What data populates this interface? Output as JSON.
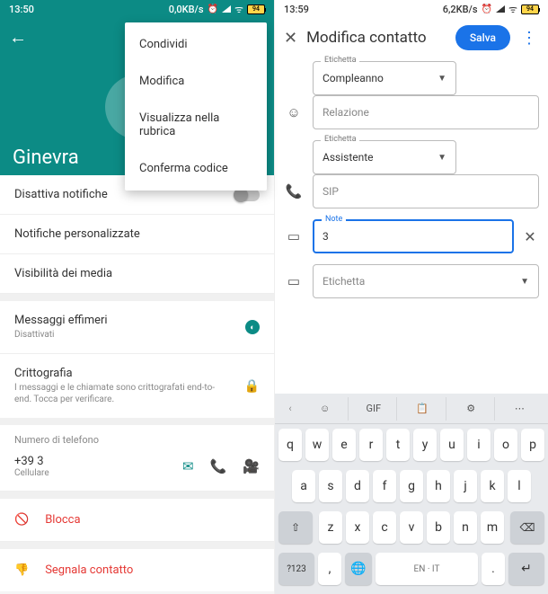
{
  "left": {
    "status": {
      "time": "13:50",
      "net": "0,0KB/s",
      "battery": "94"
    },
    "contact_name": "Ginevra",
    "menu": {
      "share": "Condividi",
      "edit": "Modifica",
      "view": "Visualizza nella rubrica",
      "verify": "Conferma codice"
    },
    "rows": {
      "mute": "Disattiva notifiche",
      "custom": "Notifiche personalizzate",
      "media": "Visibilità dei media",
      "ephemeral": "Messaggi effimeri",
      "ephemeral_sub": "Disattivati",
      "crypto": "Crittografia",
      "crypto_sub": "I messaggi e le chiamate sono crittografati end-to-end. Tocca per verificare.",
      "phone_section": "Numero di telefono",
      "phone_number": "+39 3",
      "phone_type": "Cellulare",
      "block": "Blocca",
      "report": "Segnala contatto"
    }
  },
  "right": {
    "status": {
      "time": "13:59",
      "net": "6,2KB/s",
      "battery": "94"
    },
    "header": {
      "title": "Modifica contatto",
      "save": "Salva"
    },
    "fields": {
      "birthday_label": "Etichetta",
      "birthday_value": "Compleanno",
      "relation_placeholder": "Relazione",
      "assistant_label": "Etichetta",
      "assistant_value": "Assistente",
      "sip_placeholder": "SIP",
      "note_label": "Note",
      "note_value": "3",
      "tag_placeholder": "Etichetta"
    },
    "keyboard": {
      "toolbar": {
        "gif": "GIF"
      },
      "row1": [
        "q",
        "w",
        "e",
        "r",
        "t",
        "y",
        "u",
        "i",
        "o",
        "p"
      ],
      "row2": [
        "a",
        "s",
        "d",
        "f",
        "g",
        "h",
        "j",
        "k",
        "l"
      ],
      "row3_mid": [
        "z",
        "x",
        "c",
        "v",
        "b",
        "n",
        "m"
      ],
      "sym": "?123",
      "space": "EN · IT"
    }
  }
}
